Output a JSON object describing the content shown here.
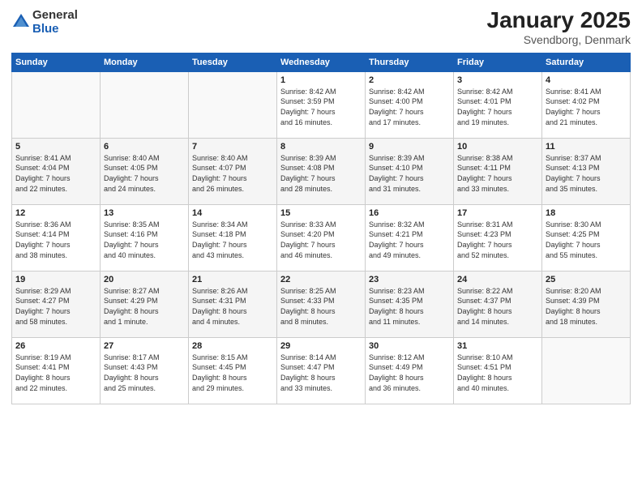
{
  "logo": {
    "general": "General",
    "blue": "Blue"
  },
  "title": "January 2025",
  "subtitle": "Svendborg, Denmark",
  "days_of_week": [
    "Sunday",
    "Monday",
    "Tuesday",
    "Wednesday",
    "Thursday",
    "Friday",
    "Saturday"
  ],
  "weeks": [
    [
      {
        "day": "",
        "content": ""
      },
      {
        "day": "",
        "content": ""
      },
      {
        "day": "",
        "content": ""
      },
      {
        "day": "1",
        "content": "Sunrise: 8:42 AM\nSunset: 3:59 PM\nDaylight: 7 hours\nand 16 minutes."
      },
      {
        "day": "2",
        "content": "Sunrise: 8:42 AM\nSunset: 4:00 PM\nDaylight: 7 hours\nand 17 minutes."
      },
      {
        "day": "3",
        "content": "Sunrise: 8:42 AM\nSunset: 4:01 PM\nDaylight: 7 hours\nand 19 minutes."
      },
      {
        "day": "4",
        "content": "Sunrise: 8:41 AM\nSunset: 4:02 PM\nDaylight: 7 hours\nand 21 minutes."
      }
    ],
    [
      {
        "day": "5",
        "content": "Sunrise: 8:41 AM\nSunset: 4:04 PM\nDaylight: 7 hours\nand 22 minutes."
      },
      {
        "day": "6",
        "content": "Sunrise: 8:40 AM\nSunset: 4:05 PM\nDaylight: 7 hours\nand 24 minutes."
      },
      {
        "day": "7",
        "content": "Sunrise: 8:40 AM\nSunset: 4:07 PM\nDaylight: 7 hours\nand 26 minutes."
      },
      {
        "day": "8",
        "content": "Sunrise: 8:39 AM\nSunset: 4:08 PM\nDaylight: 7 hours\nand 28 minutes."
      },
      {
        "day": "9",
        "content": "Sunrise: 8:39 AM\nSunset: 4:10 PM\nDaylight: 7 hours\nand 31 minutes."
      },
      {
        "day": "10",
        "content": "Sunrise: 8:38 AM\nSunset: 4:11 PM\nDaylight: 7 hours\nand 33 minutes."
      },
      {
        "day": "11",
        "content": "Sunrise: 8:37 AM\nSunset: 4:13 PM\nDaylight: 7 hours\nand 35 minutes."
      }
    ],
    [
      {
        "day": "12",
        "content": "Sunrise: 8:36 AM\nSunset: 4:14 PM\nDaylight: 7 hours\nand 38 minutes."
      },
      {
        "day": "13",
        "content": "Sunrise: 8:35 AM\nSunset: 4:16 PM\nDaylight: 7 hours\nand 40 minutes."
      },
      {
        "day": "14",
        "content": "Sunrise: 8:34 AM\nSunset: 4:18 PM\nDaylight: 7 hours\nand 43 minutes."
      },
      {
        "day": "15",
        "content": "Sunrise: 8:33 AM\nSunset: 4:20 PM\nDaylight: 7 hours\nand 46 minutes."
      },
      {
        "day": "16",
        "content": "Sunrise: 8:32 AM\nSunset: 4:21 PM\nDaylight: 7 hours\nand 49 minutes."
      },
      {
        "day": "17",
        "content": "Sunrise: 8:31 AM\nSunset: 4:23 PM\nDaylight: 7 hours\nand 52 minutes."
      },
      {
        "day": "18",
        "content": "Sunrise: 8:30 AM\nSunset: 4:25 PM\nDaylight: 7 hours\nand 55 minutes."
      }
    ],
    [
      {
        "day": "19",
        "content": "Sunrise: 8:29 AM\nSunset: 4:27 PM\nDaylight: 7 hours\nand 58 minutes."
      },
      {
        "day": "20",
        "content": "Sunrise: 8:27 AM\nSunset: 4:29 PM\nDaylight: 8 hours\nand 1 minute."
      },
      {
        "day": "21",
        "content": "Sunrise: 8:26 AM\nSunset: 4:31 PM\nDaylight: 8 hours\nand 4 minutes."
      },
      {
        "day": "22",
        "content": "Sunrise: 8:25 AM\nSunset: 4:33 PM\nDaylight: 8 hours\nand 8 minutes."
      },
      {
        "day": "23",
        "content": "Sunrise: 8:23 AM\nSunset: 4:35 PM\nDaylight: 8 hours\nand 11 minutes."
      },
      {
        "day": "24",
        "content": "Sunrise: 8:22 AM\nSunset: 4:37 PM\nDaylight: 8 hours\nand 14 minutes."
      },
      {
        "day": "25",
        "content": "Sunrise: 8:20 AM\nSunset: 4:39 PM\nDaylight: 8 hours\nand 18 minutes."
      }
    ],
    [
      {
        "day": "26",
        "content": "Sunrise: 8:19 AM\nSunset: 4:41 PM\nDaylight: 8 hours\nand 22 minutes."
      },
      {
        "day": "27",
        "content": "Sunrise: 8:17 AM\nSunset: 4:43 PM\nDaylight: 8 hours\nand 25 minutes."
      },
      {
        "day": "28",
        "content": "Sunrise: 8:15 AM\nSunset: 4:45 PM\nDaylight: 8 hours\nand 29 minutes."
      },
      {
        "day": "29",
        "content": "Sunrise: 8:14 AM\nSunset: 4:47 PM\nDaylight: 8 hours\nand 33 minutes."
      },
      {
        "day": "30",
        "content": "Sunrise: 8:12 AM\nSunset: 4:49 PM\nDaylight: 8 hours\nand 36 minutes."
      },
      {
        "day": "31",
        "content": "Sunrise: 8:10 AM\nSunset: 4:51 PM\nDaylight: 8 hours\nand 40 minutes."
      },
      {
        "day": "",
        "content": ""
      }
    ]
  ]
}
